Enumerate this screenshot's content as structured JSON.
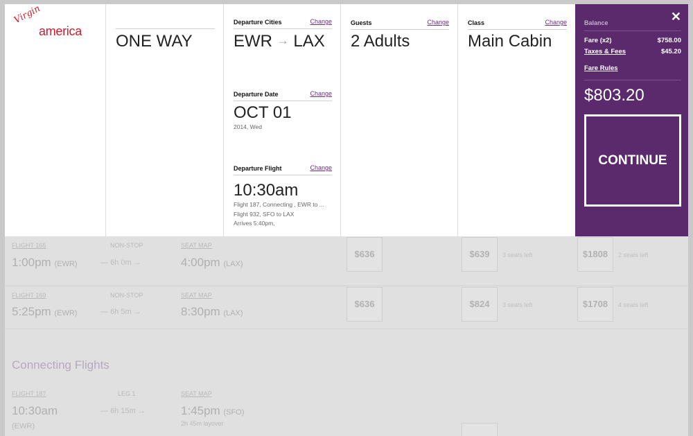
{
  "logo": {
    "script": "Virgin",
    "word": "america"
  },
  "trip": {
    "type": "ONE WAY"
  },
  "cities": {
    "label": "Departure Cities",
    "change": "Change",
    "from": "EWR",
    "arrow": "→",
    "to": "LAX"
  },
  "date": {
    "label": "Departure Date",
    "change": "Change",
    "value": "OCT 01",
    "sub": "2014, Wed"
  },
  "flight": {
    "label": "Departure Flight",
    "change": "Change",
    "value": "10:30am",
    "line1": "Flight 187, Connecting , EWR to ...",
    "line2": "Flight 932, SFO to LAX",
    "line3": "Arrives 5:40pm,"
  },
  "guests": {
    "label": "Guests",
    "change": "Change",
    "value": "2 Adults"
  },
  "class": {
    "label": "Class",
    "change": "Change",
    "value": "Main Cabin"
  },
  "balance": {
    "close": "✕",
    "title": "Balance",
    "fare_label": "Fare (x2)",
    "fare_value": "$758.00",
    "taxes_label": "Taxes & Fees",
    "taxes_value": "$45.20",
    "rules": "Fare Rules",
    "total": "$803.20",
    "continue": "CONTINUE"
  },
  "flights": [
    {
      "flight": "FLIGHT 165",
      "stops": "NON-STOP",
      "seat": "SEAT MAP",
      "dep": "1:00pm",
      "dep_ap": "(EWR)",
      "dur": "6h 0m",
      "arr": "4:00pm",
      "arr_ap": "(LAX)",
      "p1": "$636",
      "p2": "$639",
      "s2": "3 seats left",
      "p3": "$1808",
      "s3": "2 seats left"
    },
    {
      "flight": "FLIGHT 169",
      "stops": "NON-STOP",
      "seat": "SEAT MAP",
      "dep": "5:25pm",
      "dep_ap": "(EWR)",
      "dur": "6h 5m",
      "arr": "8:30pm",
      "arr_ap": "(LAX)",
      "p1": "$636",
      "p2": "$824",
      "s2": "3 seats left",
      "p3": "$1708",
      "s3": "4 seats left"
    }
  ],
  "connecting": {
    "title": "Connecting Flights",
    "flight": "FLIGHT 187",
    "leg": "LEG 1",
    "seat": "SEAT MAP",
    "dep": "10:30am",
    "dep_ap": "(EWR)",
    "dur": "6h 15m",
    "arr": "1:45pm",
    "arr_ap": "(SFO)",
    "layover": "2h 45m layover"
  }
}
